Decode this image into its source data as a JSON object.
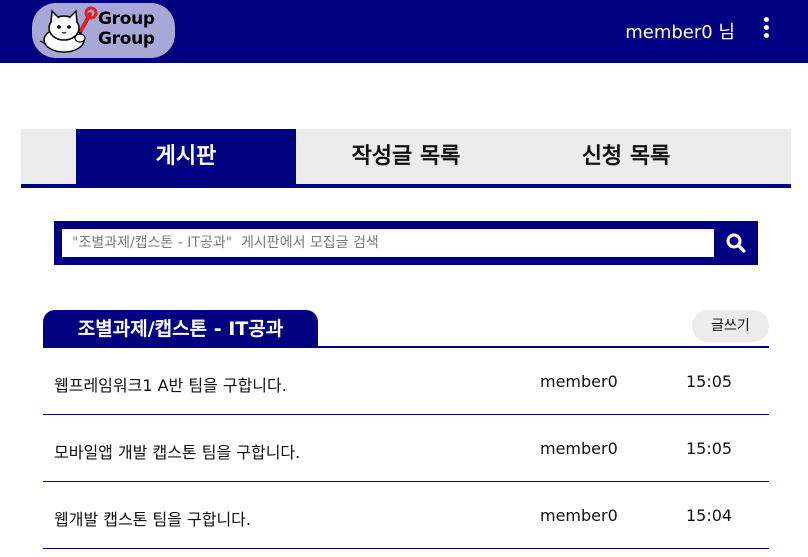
{
  "header": {
    "logo_text_line1": "Group",
    "logo_text_line2": "Group",
    "user_label": "member0 님",
    "menu_icon": "kebab-menu-icon"
  },
  "tabs": [
    {
      "label": "게시판",
      "active": true
    },
    {
      "label": "작성글 목록",
      "active": false
    },
    {
      "label": "신청 목록",
      "active": false
    }
  ],
  "search": {
    "placeholder": "\"조별과제/캡스톤 - IT공과\"  게시판에서 모집글 검색",
    "value": "",
    "icon": "search-icon"
  },
  "board": {
    "title": "조별과제/캡스톤 - IT공과",
    "write_label": "글쓰기",
    "posts": [
      {
        "title": "웹프레임워크1 A반 팀을 구합니다.",
        "author": "member0",
        "time": "15:05"
      },
      {
        "title": "모바일앱 개발 캡스톤 팀을 구합니다.",
        "author": "member0",
        "time": "15:05"
      },
      {
        "title": "웹개발 캡스톤 팀을 구합니다.",
        "author": "member0",
        "time": "15:04"
      }
    ]
  },
  "colors": {
    "primary": "#000080",
    "tab_background": "#ececec",
    "logo_background": "#a8a8d8",
    "accent_red": "#e02020"
  }
}
